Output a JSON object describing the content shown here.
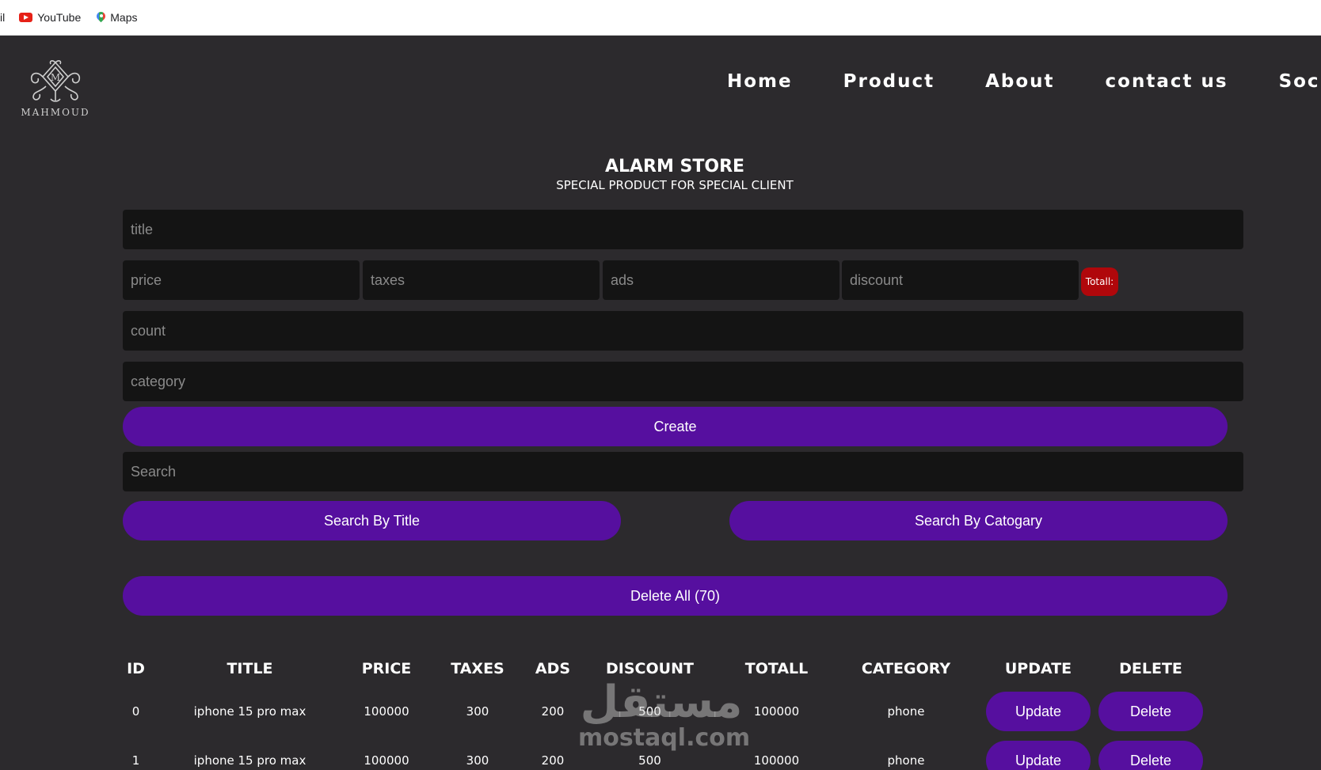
{
  "bookmarks": {
    "cut_label": "il",
    "youtube_label": "YouTube",
    "maps_label": "Maps"
  },
  "brand": {
    "name": "MAHMOUD",
    "monogram": "M"
  },
  "nav": [
    "Home",
    "Product",
    "About",
    "contact us",
    "Social"
  ],
  "header": {
    "title": "ALARM STORE",
    "subtitle": "SPECIAL PRODUCT FOR SPECIAL CLIENT"
  },
  "form": {
    "title_placeholder": "title",
    "price_placeholder": "price",
    "taxes_placeholder": "taxes",
    "ads_placeholder": "ads",
    "discount_placeholder": "discount",
    "total_label": "Totall:",
    "count_placeholder": "count",
    "category_placeholder": "category",
    "create_label": "Create"
  },
  "search": {
    "placeholder": "Search",
    "by_title_label": "Search By Title",
    "by_category_label": "Search By Catogary"
  },
  "delete_all_label": "Delete All (70)",
  "table": {
    "headers": [
      "ID",
      "TITLE",
      "PRICE",
      "TAXES",
      "ADS",
      "DISCOUNT",
      "TOTALL",
      "CATEGORY",
      "UPDATE",
      "DELETE"
    ],
    "update_label": "Update",
    "delete_label": "Delete",
    "rows": [
      {
        "id": "0",
        "title": "iphone 15 pro max",
        "price": "100000",
        "taxes": "300",
        "ads": "200",
        "discount": "500",
        "total": "100000",
        "category": "phone"
      },
      {
        "id": "1",
        "title": "iphone 15 pro max",
        "price": "100000",
        "taxes": "300",
        "ads": "200",
        "discount": "500",
        "total": "100000",
        "category": "phone"
      }
    ]
  },
  "watermark": {
    "arabic": "مستقل",
    "latin": "mostaql.com"
  },
  "colors": {
    "background": "#2c2a2d",
    "input": "#141414",
    "accent": "#560f9f",
    "total_badge": "#b0070b"
  },
  "icons": [
    "youtube-icon",
    "maps-pin-icon",
    "ornament-logo-icon"
  ]
}
